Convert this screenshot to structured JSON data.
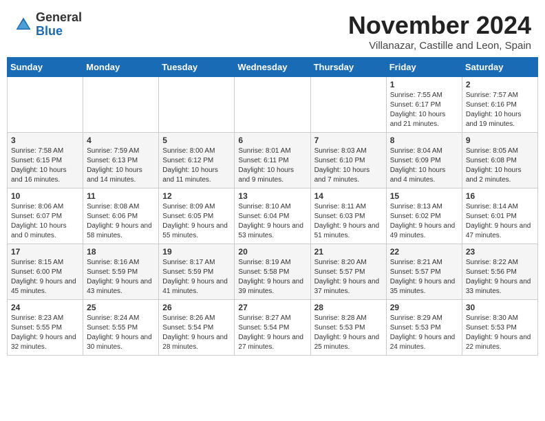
{
  "header": {
    "logo_general": "General",
    "logo_blue": "Blue",
    "month_title": "November 2024",
    "location": "Villanazar, Castille and Leon, Spain"
  },
  "weekdays": [
    "Sunday",
    "Monday",
    "Tuesday",
    "Wednesday",
    "Thursday",
    "Friday",
    "Saturday"
  ],
  "weeks": [
    [
      {
        "day": "",
        "info": ""
      },
      {
        "day": "",
        "info": ""
      },
      {
        "day": "",
        "info": ""
      },
      {
        "day": "",
        "info": ""
      },
      {
        "day": "",
        "info": ""
      },
      {
        "day": "1",
        "info": "Sunrise: 7:55 AM\nSunset: 6:17 PM\nDaylight: 10 hours and 21 minutes."
      },
      {
        "day": "2",
        "info": "Sunrise: 7:57 AM\nSunset: 6:16 PM\nDaylight: 10 hours and 19 minutes."
      }
    ],
    [
      {
        "day": "3",
        "info": "Sunrise: 7:58 AM\nSunset: 6:15 PM\nDaylight: 10 hours and 16 minutes."
      },
      {
        "day": "4",
        "info": "Sunrise: 7:59 AM\nSunset: 6:13 PM\nDaylight: 10 hours and 14 minutes."
      },
      {
        "day": "5",
        "info": "Sunrise: 8:00 AM\nSunset: 6:12 PM\nDaylight: 10 hours and 11 minutes."
      },
      {
        "day": "6",
        "info": "Sunrise: 8:01 AM\nSunset: 6:11 PM\nDaylight: 10 hours and 9 minutes."
      },
      {
        "day": "7",
        "info": "Sunrise: 8:03 AM\nSunset: 6:10 PM\nDaylight: 10 hours and 7 minutes."
      },
      {
        "day": "8",
        "info": "Sunrise: 8:04 AM\nSunset: 6:09 PM\nDaylight: 10 hours and 4 minutes."
      },
      {
        "day": "9",
        "info": "Sunrise: 8:05 AM\nSunset: 6:08 PM\nDaylight: 10 hours and 2 minutes."
      }
    ],
    [
      {
        "day": "10",
        "info": "Sunrise: 8:06 AM\nSunset: 6:07 PM\nDaylight: 10 hours and 0 minutes."
      },
      {
        "day": "11",
        "info": "Sunrise: 8:08 AM\nSunset: 6:06 PM\nDaylight: 9 hours and 58 minutes."
      },
      {
        "day": "12",
        "info": "Sunrise: 8:09 AM\nSunset: 6:05 PM\nDaylight: 9 hours and 55 minutes."
      },
      {
        "day": "13",
        "info": "Sunrise: 8:10 AM\nSunset: 6:04 PM\nDaylight: 9 hours and 53 minutes."
      },
      {
        "day": "14",
        "info": "Sunrise: 8:11 AM\nSunset: 6:03 PM\nDaylight: 9 hours and 51 minutes."
      },
      {
        "day": "15",
        "info": "Sunrise: 8:13 AM\nSunset: 6:02 PM\nDaylight: 9 hours and 49 minutes."
      },
      {
        "day": "16",
        "info": "Sunrise: 8:14 AM\nSunset: 6:01 PM\nDaylight: 9 hours and 47 minutes."
      }
    ],
    [
      {
        "day": "17",
        "info": "Sunrise: 8:15 AM\nSunset: 6:00 PM\nDaylight: 9 hours and 45 minutes."
      },
      {
        "day": "18",
        "info": "Sunrise: 8:16 AM\nSunset: 5:59 PM\nDaylight: 9 hours and 43 minutes."
      },
      {
        "day": "19",
        "info": "Sunrise: 8:17 AM\nSunset: 5:59 PM\nDaylight: 9 hours and 41 minutes."
      },
      {
        "day": "20",
        "info": "Sunrise: 8:19 AM\nSunset: 5:58 PM\nDaylight: 9 hours and 39 minutes."
      },
      {
        "day": "21",
        "info": "Sunrise: 8:20 AM\nSunset: 5:57 PM\nDaylight: 9 hours and 37 minutes."
      },
      {
        "day": "22",
        "info": "Sunrise: 8:21 AM\nSunset: 5:57 PM\nDaylight: 9 hours and 35 minutes."
      },
      {
        "day": "23",
        "info": "Sunrise: 8:22 AM\nSunset: 5:56 PM\nDaylight: 9 hours and 33 minutes."
      }
    ],
    [
      {
        "day": "24",
        "info": "Sunrise: 8:23 AM\nSunset: 5:55 PM\nDaylight: 9 hours and 32 minutes."
      },
      {
        "day": "25",
        "info": "Sunrise: 8:24 AM\nSunset: 5:55 PM\nDaylight: 9 hours and 30 minutes."
      },
      {
        "day": "26",
        "info": "Sunrise: 8:26 AM\nSunset: 5:54 PM\nDaylight: 9 hours and 28 minutes."
      },
      {
        "day": "27",
        "info": "Sunrise: 8:27 AM\nSunset: 5:54 PM\nDaylight: 9 hours and 27 minutes."
      },
      {
        "day": "28",
        "info": "Sunrise: 8:28 AM\nSunset: 5:53 PM\nDaylight: 9 hours and 25 minutes."
      },
      {
        "day": "29",
        "info": "Sunrise: 8:29 AM\nSunset: 5:53 PM\nDaylight: 9 hours and 24 minutes."
      },
      {
        "day": "30",
        "info": "Sunrise: 8:30 AM\nSunset: 5:53 PM\nDaylight: 9 hours and 22 minutes."
      }
    ]
  ]
}
